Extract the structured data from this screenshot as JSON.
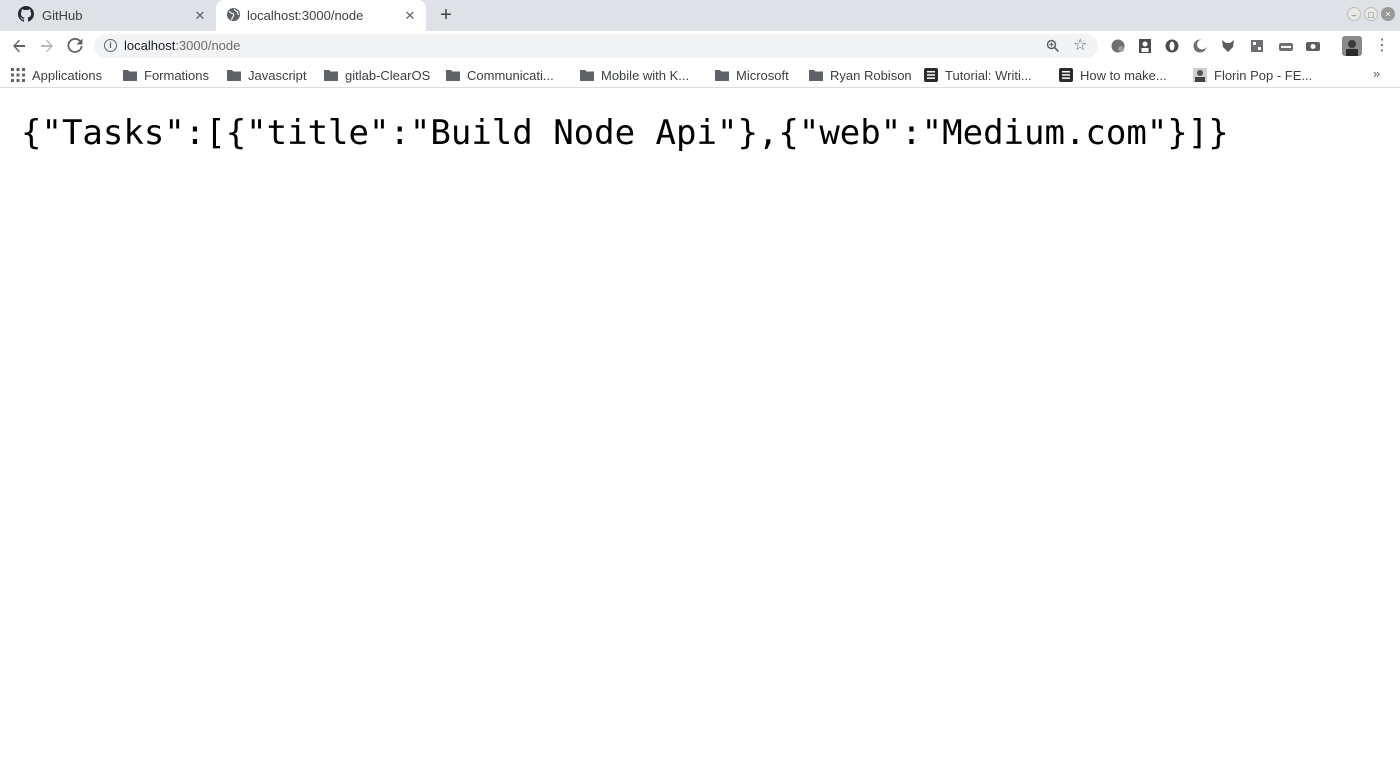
{
  "tabs": [
    {
      "label": "GitHub",
      "icon": "github-icon",
      "active": false
    },
    {
      "label": "localhost:3000/node",
      "icon": "globe-icon",
      "active": true
    }
  ],
  "window_controls": {
    "minimize": "–",
    "maximize": "□",
    "close": "×"
  },
  "toolbar": {
    "url_host": "localhost",
    "url_path": ":3000/node"
  },
  "bookmarks": [
    {
      "label": "Applications",
      "icon": "apps-grid-icon"
    },
    {
      "label": "Formations",
      "icon": "folder-icon"
    },
    {
      "label": "Javascript",
      "icon": "folder-icon"
    },
    {
      "label": "gitlab-ClearOS",
      "icon": "folder-icon"
    },
    {
      "label": "Communicati...",
      "icon": "folder-icon"
    },
    {
      "label": "Mobile with K...",
      "icon": "folder-icon"
    },
    {
      "label": "Microsoft",
      "icon": "folder-icon"
    },
    {
      "label": "Ryan Robison",
      "icon": "folder-icon"
    },
    {
      "label": "Tutorial: Writi...",
      "icon": "page-favicon-icon"
    },
    {
      "label": "How to make...",
      "icon": "page-favicon-icon"
    },
    {
      "label": "Florin Pop - FE...",
      "icon": "profile-favicon-icon"
    }
  ],
  "page": {
    "body_text": "{\"Tasks\":[{\"title\":\"Build Node Api\"},{\"web\":\"Medium.com\"}]}"
  },
  "colors": {
    "tabstrip": "#dee1e6",
    "omnibox": "#f1f3f4",
    "icon": "#5f6368"
  }
}
